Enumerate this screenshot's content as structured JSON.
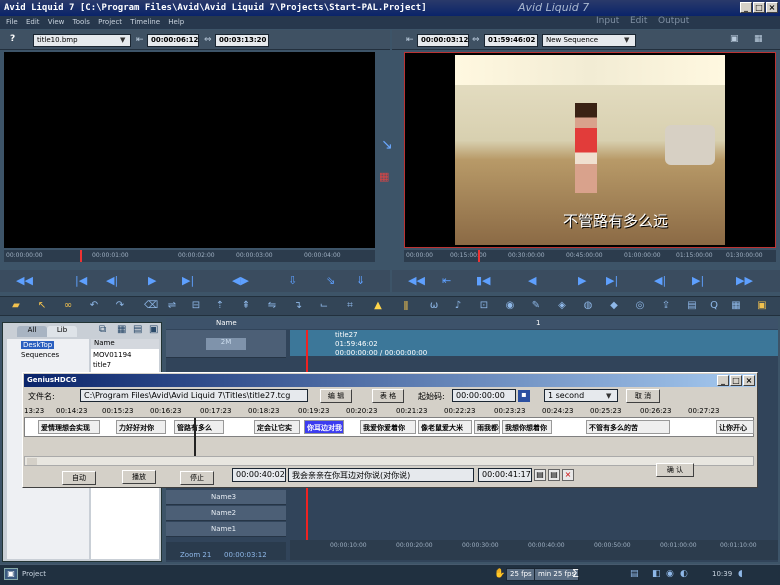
{
  "window": {
    "title": "Avid Liquid 7 [C:\\Program Files\\Avid\\Avid Liquid 7\\Projects\\Start-PAL.Project]",
    "watermark": "Avid Liquid 7"
  },
  "menu": {
    "items": [
      "File",
      "Edit",
      "View",
      "Tools",
      "Project",
      "Timeline",
      "Help"
    ],
    "modes": [
      "Input",
      "Edit",
      "Output"
    ]
  },
  "source": {
    "help": "?",
    "clip": "title10.bmp",
    "tc_in": "00:00:06:12",
    "tc_dur": "00:03:13:20",
    "ruler": [
      "00:00:00:00",
      "00:00:01:00",
      "00:00:02:00",
      "00:00:03:00",
      "00:00:04:00"
    ]
  },
  "record": {
    "tc_in": "00:00:03:12",
    "tc_dur": "01:59:46:02",
    "sequence": "New Sequence",
    "ruler": [
      "00:00:00",
      "00:15:00:00",
      "00:30:00:00",
      "00:45:00:00",
      "01:00:00:00",
      "01:15:00:00",
      "01:30:00:00"
    ],
    "subtitle": "不管路有多么远"
  },
  "bin": {
    "tabs": [
      "All",
      "Lib"
    ],
    "tree": [
      "DeskTop",
      "Sequences"
    ],
    "col_name": "Name",
    "items": [
      "MOV01194",
      "title7"
    ]
  },
  "timeline": {
    "header_name": "Name",
    "marker": "1",
    "clip_label": "2M",
    "clip": {
      "name": "title27",
      "tc": "01:59:46:02",
      "range": "00:00:00:00 / 00:00:00:00"
    },
    "tracks": [
      "Name3",
      "Name2",
      "Name1"
    ],
    "zoom": "Zoom 21",
    "zoom_tc": "00:00:03:12",
    "ruler": [
      "00:00:10:00",
      "00:00:20:00",
      "00:00:30:00",
      "00:00:40:00",
      "00:00:50:00",
      "00:01:00:00",
      "00:01:10:00"
    ]
  },
  "dialog": {
    "title": "GeniusHDCG",
    "file_label": "文件名:",
    "file_path": "C:\\Program Files\\Avid\\Avid Liquid 7\\Titles\\title27.tcg",
    "edit_btn": "编 辑",
    "table_btn": "表 格",
    "start_label": "起始码:",
    "start_tc": "00:00:00:00",
    "duration": "1 second",
    "cancel_btn": "取 消",
    "ruler": [
      "13:23",
      "00:14:23",
      "00:15:23",
      "00:16:23",
      "00:17:23",
      "00:18:23",
      "00:19:23",
      "00:20:23",
      "00:21:23",
      "00:22:23",
      "00:23:23",
      "00:24:23",
      "00:25:23",
      "00:26:23",
      "00:27:23"
    ],
    "cues": [
      "爱情理想会实现",
      "力好好对你",
      "管路有多么",
      "定会让它实",
      "你耳边对我",
      "我爱你爱着你",
      "像老鼠爱大米",
      "雨我都会",
      "我想你想着你",
      "不管有多么的苦",
      "让你开心"
    ],
    "auto_btn": "自动",
    "play_btn": "播放",
    "stop_btn": "停止",
    "cur_in": "00:00:40:02",
    "cur_text": "我会亲亲在你耳边对你说(对你说)",
    "cur_out": "00:00:41:17",
    "ok_btn": "确 认"
  },
  "status": {
    "start": "Project",
    "fps1": "25 fps",
    "fps2": "min 25 fps",
    "clock": "10:39"
  }
}
